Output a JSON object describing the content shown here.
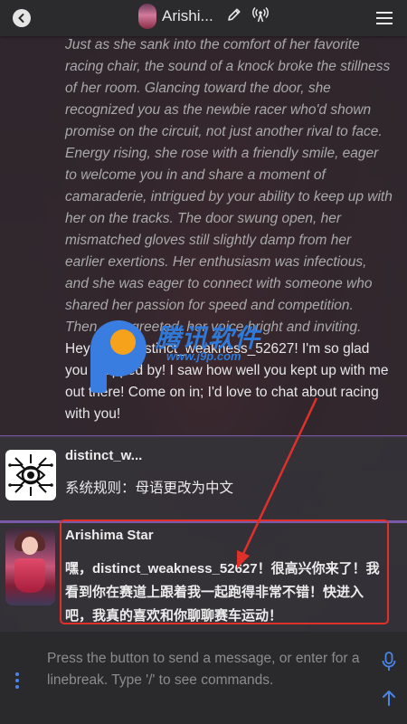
{
  "header": {
    "title": "Arishi...",
    "icons": [
      "back-arrow-icon",
      "pencil-icon",
      "broadcast-icon",
      "hamburger-menu-icon"
    ]
  },
  "messages": {
    "long": {
      "narration": "Just as she sank into the comfort of her favorite racing chair, the sound of a knock broke the stillness of her room. Glancing toward the door, she recognized you as the newbie racer who'd shown promise on the circuit, not just another rival to face. Energy rising, she rose with a friendly smile, eager to welcome you in and share a moment of camaraderie, intrigued by your ability to keep up with her on the tracks. The door swung open, her mismatched gloves still slightly damp from her earlier exertions. Her enthusiasm was infectious, and she was eager to connect with someone who shared her passion for speed and competition. Then, she greeted, her voice bright and inviting.",
      "speech": "Hey there, distinct_weakness_52627! I'm so glad you dropped by! I saw how well you kept up with me out there! Come on in; I'd love to chat about racing with you!"
    },
    "user": {
      "name": "distinct_w...",
      "text": "系统规则：母语更改为中文"
    },
    "character": {
      "name": "Arishima Star",
      "text": "嘿，distinct_weakness_52627！很高兴你来了！我看到你在赛道上跟着我一起跑得非常不错！快进入吧，我真的喜欢和你聊聊赛车运动！"
    }
  },
  "watermark": {
    "text": "腾讯软件",
    "url": "www.j9p.com"
  },
  "input": {
    "placeholder": "Press the button to send a message, or enter for a linebreak. Type '/' to see commands."
  },
  "colors": {
    "separator": "#7a5aa8",
    "highlight_box": "#e0302a",
    "arrow": "#e0302a",
    "accent_blue": "#4a86e8"
  }
}
